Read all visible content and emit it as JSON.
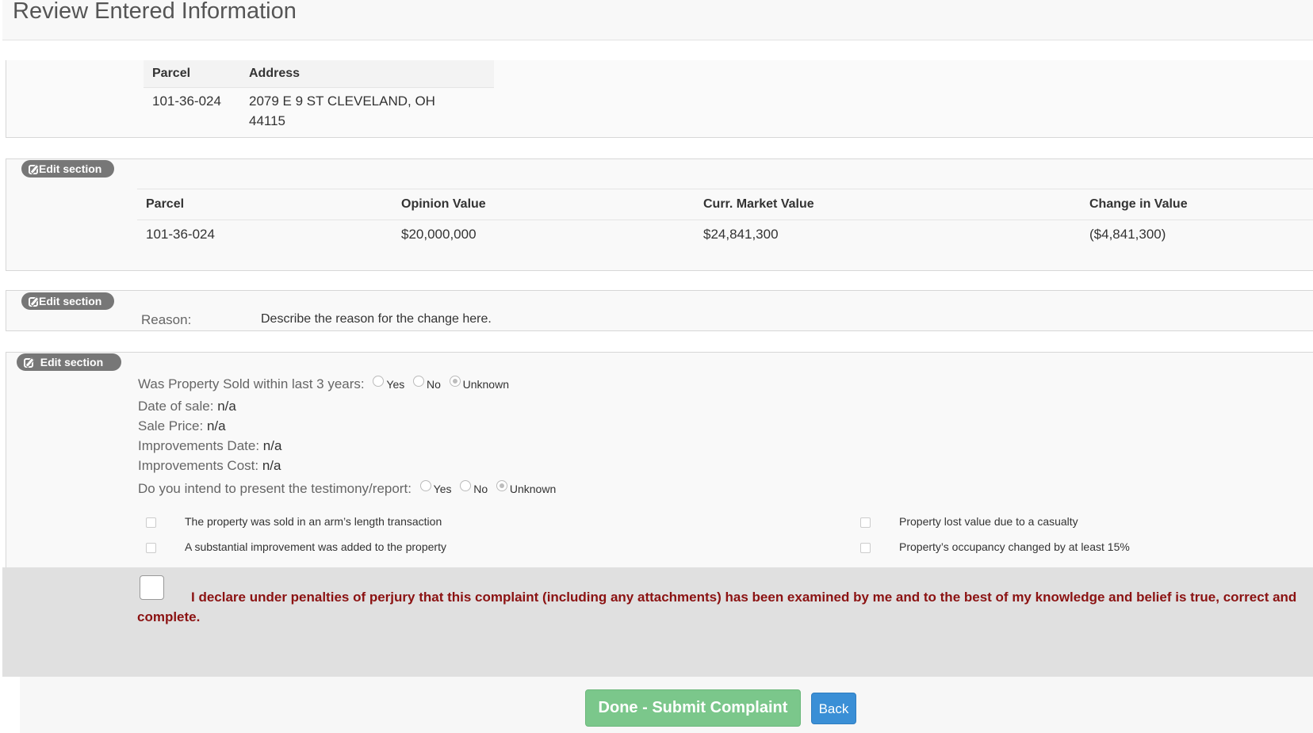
{
  "page_title": "Review Entered Information",
  "edit_label": "Edit section",
  "parcel_section": {
    "headers": {
      "parcel": "Parcel",
      "address": "Address"
    },
    "row": {
      "parcel": "101-36-024",
      "address_line1": "2079 E 9 ST CLEVELAND, OH",
      "address_line2": "44115"
    }
  },
  "value_section": {
    "headers": {
      "parcel": "Parcel",
      "opinion": "Opinion Value",
      "market": "Curr. Market Value",
      "change": "Change in Value"
    },
    "row": {
      "parcel": "101-36-024",
      "opinion": "$20,000,000",
      "market": "$24,841,300",
      "change": "($4,841,300)"
    }
  },
  "reason_section": {
    "label": "Reason:",
    "value": "Describe the reason for the change here."
  },
  "sale_section": {
    "sold_label": "Was Property Sold within last 3 years:",
    "sold_options": [
      "Yes",
      "No",
      "Unknown"
    ],
    "sold_selected": "Unknown",
    "date_label": "Date of sale:",
    "date_value": "n/a",
    "price_label": "Sale Price:",
    "price_value": "n/a",
    "impr_date_label": "Improvements Date:",
    "impr_date_value": "n/a",
    "impr_cost_label": "Improvements Cost:",
    "impr_cost_value": "n/a",
    "testimony_label": "Do you intend to present the testimony/report:",
    "testimony_options": [
      "Yes",
      "No",
      "Unknown"
    ],
    "testimony_selected": "Unknown",
    "checkboxes": {
      "arms_length": "The property was sold in an arm’s length transaction",
      "improvement": "A substantial improvement was added to the property",
      "casualty": "Property lost value due to a casualty",
      "occupancy": "Property’s occupancy changed by at least 15%"
    }
  },
  "declaration": "I declare under penalties of perjury that this complaint (including any attachments) has been examined by me and to the best of my knowledge and belief is true, correct and complete.",
  "buttons": {
    "submit": "Done - Submit Complaint",
    "back": "Back"
  }
}
